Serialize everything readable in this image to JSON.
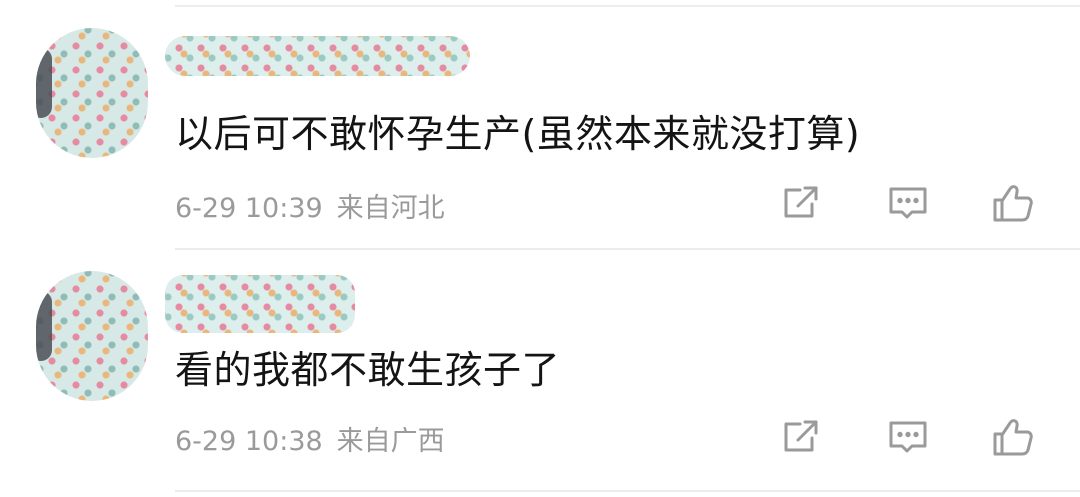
{
  "comments": [
    {
      "username_obscured": "",
      "text": "以后可不敢怀孕生产(虽然本来就没打算)",
      "date_time": "6-29 10:39",
      "location": "来自河北"
    },
    {
      "username_obscured": "",
      "text": "看的我都不敢生孩子了",
      "date_time": "6-29 10:38",
      "location": "来自广西"
    }
  ],
  "actions": {
    "share_icon": "share-icon",
    "reply_icon": "comment-icon",
    "like_icon": "thumbs-up-icon"
  },
  "colors": {
    "text": "#141414",
    "meta": "#9a9a9a",
    "icon": "#9a9a9a",
    "divider": "#ececec",
    "background": "#ffffff"
  }
}
